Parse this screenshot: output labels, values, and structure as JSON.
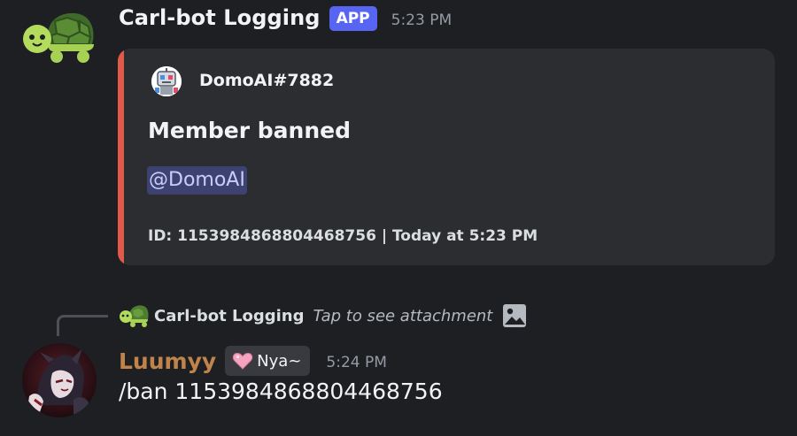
{
  "messages": [
    {
      "author": "Carl-bot Logging",
      "badge": "APP",
      "timestamp": "5:23 PM",
      "avatar_icon": "turtle-avatar",
      "embed": {
        "accent_color": "#e0594a",
        "author_name": "DomoAI#7882",
        "author_icon": "robot-avatar-icon",
        "title": "Member banned",
        "mention": "@DomoAI",
        "footer": "ID: 1153984868804468756 | Today at 5:23 PM"
      }
    },
    {
      "reply": {
        "author": "Carl-bot Logging",
        "text": "Tap to see attachment",
        "icon": "image-icon"
      },
      "author": "Luumyy",
      "author_color": "#c0844a",
      "role_tag": {
        "icon": "pink-heart-icon",
        "label": "Nya~"
      },
      "timestamp": "5:24 PM",
      "content": "/ban 1153984868804468756"
    }
  ]
}
